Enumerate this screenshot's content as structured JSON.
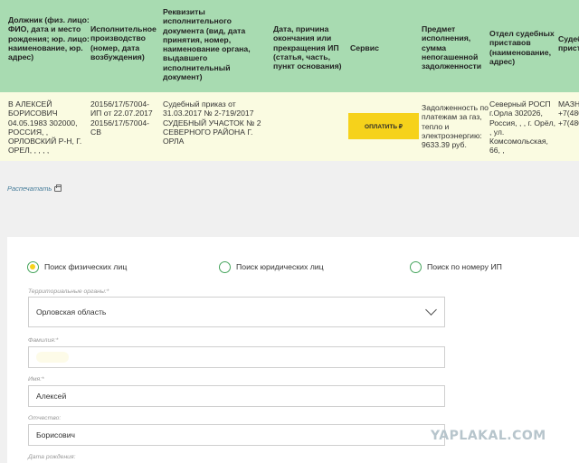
{
  "table": {
    "headers": [
      "Должник (физ. лицо: ФИО, дата и место рождения; юр. лицо: наименование, юр. адрес)",
      "Исполнительное производство (номер, дата возбуждения)",
      "Реквизиты исполнительного документа (вид, дата принятия, номер, наименование органа, выдавшего исполнительный документ)",
      "Дата, причина окончания или прекращения ИП (статья, часть, пункт основания)",
      "Сервис",
      "Предмет исполнения, сумма непогашенной задолженности",
      "Отдел судебных приставов (наименование, адрес)",
      "Судеб прист"
    ],
    "row": {
      "debtor": "В АЛЕКСЕЙ БОРИСОВИЧ 04.05.1983 302000, РОССИЯ, , ОРЛОВСКИЙ Р-Н, Г. ОРЕЛ, , , , ,",
      "proceeding": "20156/17/57004-ИП от 22.07.2017 20156/17/57004-СВ",
      "document": "Судебный приказ от 31.03.2017 № 2-719/2017 СУДЕБНЫЙ УЧАСТОК № 2 СЕВЕРНОГО РАЙОНА Г. ОРЛА",
      "end_date": "",
      "pay_button": "ОПЛАТИТЬ ₽",
      "subject": "Задолженность по платежам за газ, тепло и электроэнергию: 9633.39 руб.",
      "department": "Северный РОСП г.Орла 302026, Россия, , , г. Орёл, , ул. Комсомольская, 66, ,",
      "bailiff": "МАЗН +7(480 72 +7(480 87"
    }
  },
  "print_link": "Распечатать",
  "form": {
    "radios": [
      {
        "label": "Поиск физических лиц",
        "selected": true
      },
      {
        "label": "Поиск юридических лиц",
        "selected": false
      },
      {
        "label": "Поиск по номеру ИП",
        "selected": false
      }
    ],
    "territorial_label": "Территориальные органы:*",
    "territorial_value": "Орловская область",
    "surname_label": "Фамилия:*",
    "surname_value": "",
    "name_label": "Имя:*",
    "name_value": "Алексей",
    "patronymic_label": "Отчество:",
    "patronymic_value": "Борисович",
    "birthdate_label": "Дата рождения:"
  },
  "watermark": "YAPLAKAL.COM",
  "colors": {
    "header_bg": "#a8dbb1",
    "row_bg": "#fafbe1",
    "pay_button": "#f6d21b",
    "radio_border": "#46a55d"
  }
}
